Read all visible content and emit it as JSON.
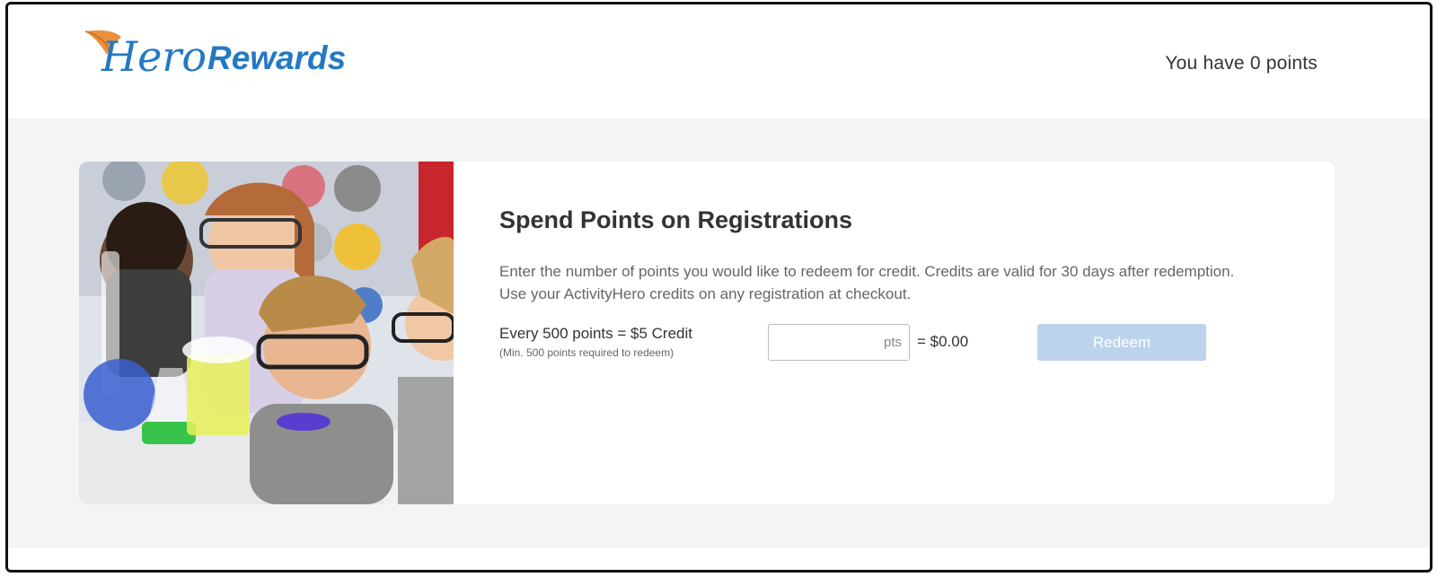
{
  "header": {
    "logo_text_script": "Hero",
    "logo_text_bold": "Rewards",
    "points_status": "You have 0 points"
  },
  "card": {
    "title": "Spend Points on Registrations",
    "description": "Enter the number of points you would like to redeem for credit. Credits are valid for 30 days after redemption. Use your ActivityHero credits on any registration at checkout.",
    "rate_label": "Every 500 points = $5 Credit",
    "rate_note": "(Min. 500 points required to redeem)",
    "points_input": {
      "value": "",
      "suffix": "pts"
    },
    "credit_value": "= $0.00",
    "redeem_label": "Redeem"
  },
  "colors": {
    "brand_blue": "#2479c2",
    "brand_orange": "#e8903a",
    "button_disabled": "#bcd3ec",
    "background": "#f4f4f4"
  }
}
